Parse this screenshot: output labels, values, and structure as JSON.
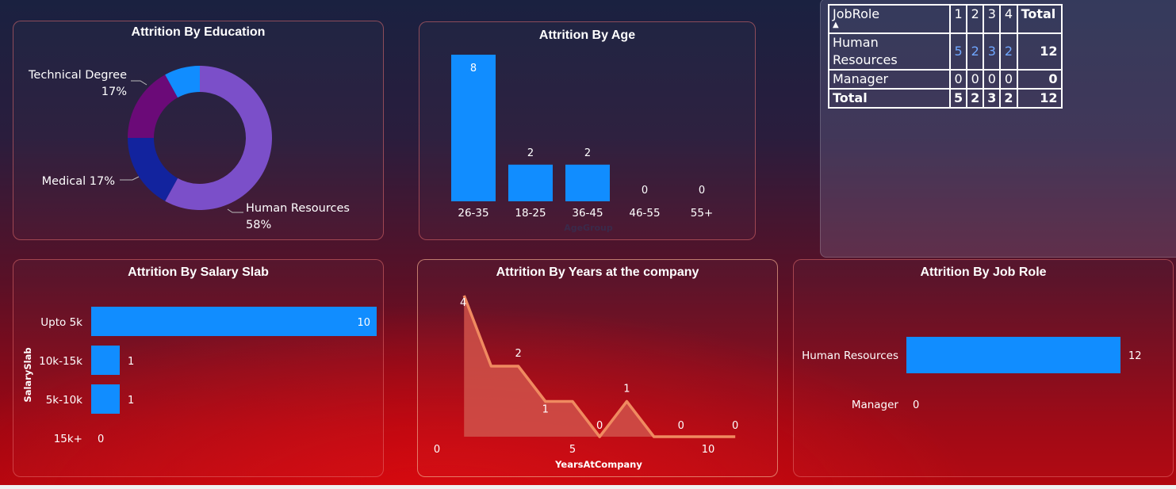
{
  "colors": {
    "bar": "#118dff",
    "donut_human_resources": "#7b4fc9",
    "donut_medical": "#12239e",
    "donut_technical": "#6b0a78",
    "donut_other": "#118dff",
    "area_line": "#f08a60",
    "area_fill": "#d0524a"
  },
  "matrix": {
    "header": [
      "JobRole",
      "1",
      "2",
      "3",
      "4",
      "Total"
    ],
    "rows": [
      {
        "label": "Human Resources",
        "values": [
          "5",
          "2",
          "3",
          "2"
        ],
        "total": "12"
      },
      {
        "label": "Manager",
        "values": [
          "0",
          "0",
          "0",
          "0"
        ],
        "total": "0"
      }
    ],
    "total_row": {
      "label": "Total",
      "values": [
        "5",
        "2",
        "3",
        "2"
      ],
      "total": "12"
    }
  },
  "chart_data": [
    {
      "type": "pie",
      "title": "Attrition By Education",
      "slices": [
        {
          "name": "Human Resources",
          "value": 58,
          "label": "Human Resources 58%"
        },
        {
          "name": "Medical",
          "value": 17,
          "label": "Medical 17%"
        },
        {
          "name": "Technical Degree",
          "value": 17,
          "label": "Technical Degree 17%"
        },
        {
          "name": "",
          "value": 8,
          "label": ""
        }
      ]
    },
    {
      "type": "bar",
      "title": "Attrition By Age",
      "xlabel": "AgeGroup",
      "categories": [
        "26-35",
        "18-25",
        "36-45",
        "46-55",
        "55+"
      ],
      "values": [
        8,
        2,
        2,
        0,
        0
      ],
      "ylim": [
        0,
        8
      ]
    },
    {
      "type": "bar",
      "orientation": "horizontal",
      "title": "Attrition By Salary Slab",
      "ylabel": "SalarySlab",
      "categories": [
        "Upto 5k",
        "10k-15k",
        "5k-10k",
        "15k+"
      ],
      "values": [
        10,
        1,
        1,
        0
      ],
      "xlim": [
        0,
        10
      ]
    },
    {
      "type": "area",
      "title": "Attrition By Years at the company",
      "xlabel": "YearsAtCompany",
      "x": [
        1,
        2,
        3,
        4,
        5,
        6,
        7,
        8,
        9,
        10,
        11
      ],
      "y": [
        4,
        2,
        2,
        1,
        1,
        0,
        1,
        0,
        0,
        0,
        0
      ],
      "point_labels": [
        {
          "x": 1,
          "y": 4,
          "text": "4"
        },
        {
          "x": 3,
          "y": 2,
          "text": "2"
        },
        {
          "x": 4,
          "y": 1,
          "text": "1"
        },
        {
          "x": 6,
          "y": 0,
          "text": "0"
        },
        {
          "x": 7,
          "y": 1,
          "text": "1"
        },
        {
          "x": 9,
          "y": 0,
          "text": "0"
        },
        {
          "x": 11,
          "y": 0,
          "text": "0"
        }
      ],
      "xticks": [
        0,
        5,
        10
      ],
      "xlim": [
        0,
        11
      ],
      "ylim": [
        0,
        4
      ]
    },
    {
      "type": "bar",
      "orientation": "horizontal",
      "title": "Attrition By Job Role",
      "categories": [
        "Human Resources",
        "Manager"
      ],
      "values": [
        12,
        0
      ],
      "xlim": [
        0,
        12
      ]
    }
  ]
}
